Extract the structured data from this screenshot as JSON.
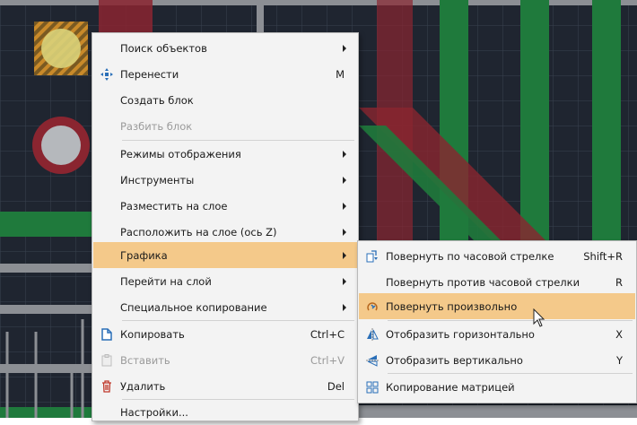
{
  "colors": {
    "background": "#1f2530",
    "grid": "#3a4250",
    "trace_green": "#1f7a3c",
    "trace_red": "#8a2530",
    "trace_gray": "#8c8f94",
    "pad_yellow": "#d9d27a",
    "hatch": "#c97a1e",
    "menu_bg": "#f3f3f3",
    "highlight": "#f4c98a"
  },
  "context_menu": {
    "items": [
      {
        "label": "Поиск объектов",
        "submenu": true
      },
      {
        "label": "Перенести",
        "shortcut": "M",
        "icon": "move-icon"
      },
      {
        "label": "Создать блок"
      },
      {
        "label": "Разбить блок",
        "disabled": true
      },
      {
        "label": "Режимы отображения",
        "submenu": true
      },
      {
        "label": "Инструменты",
        "submenu": true
      },
      {
        "label": "Разместить на слое",
        "submenu": true
      },
      {
        "label": "Расположить на слое (ось Z)",
        "submenu": true
      },
      {
        "label": "Графика",
        "submenu": true,
        "highlighted": true
      },
      {
        "label": "Перейти на слой",
        "submenu": true
      },
      {
        "label": "Специальное копирование",
        "submenu": true
      },
      {
        "label": "Копировать",
        "shortcut": "Ctrl+C",
        "icon": "copy-icon"
      },
      {
        "label": "Вставить",
        "shortcut": "Ctrl+V",
        "icon": "paste-icon",
        "disabled": true
      },
      {
        "label": "Удалить",
        "shortcut": "Del",
        "icon": "delete-icon"
      },
      {
        "label": "Настройки..."
      }
    ]
  },
  "graphics_submenu": {
    "items": [
      {
        "label": "Повернуть по часовой стрелке",
        "shortcut": "Shift+R",
        "icon": "rotate-clockwise-icon"
      },
      {
        "label": "Повернуть против часовой стрелки",
        "shortcut": "R"
      },
      {
        "label": "Повернуть произвольно",
        "icon": "rotate-free-icon",
        "highlighted": true
      },
      {
        "label": "Отобразить горизонтально",
        "shortcut": "X",
        "icon": "mirror-horizontal-icon"
      },
      {
        "label": "Отобразить вертикально",
        "shortcut": "Y",
        "icon": "mirror-vertical-icon"
      },
      {
        "label": "Копирование матрицей",
        "icon": "array-copy-icon"
      }
    ]
  }
}
